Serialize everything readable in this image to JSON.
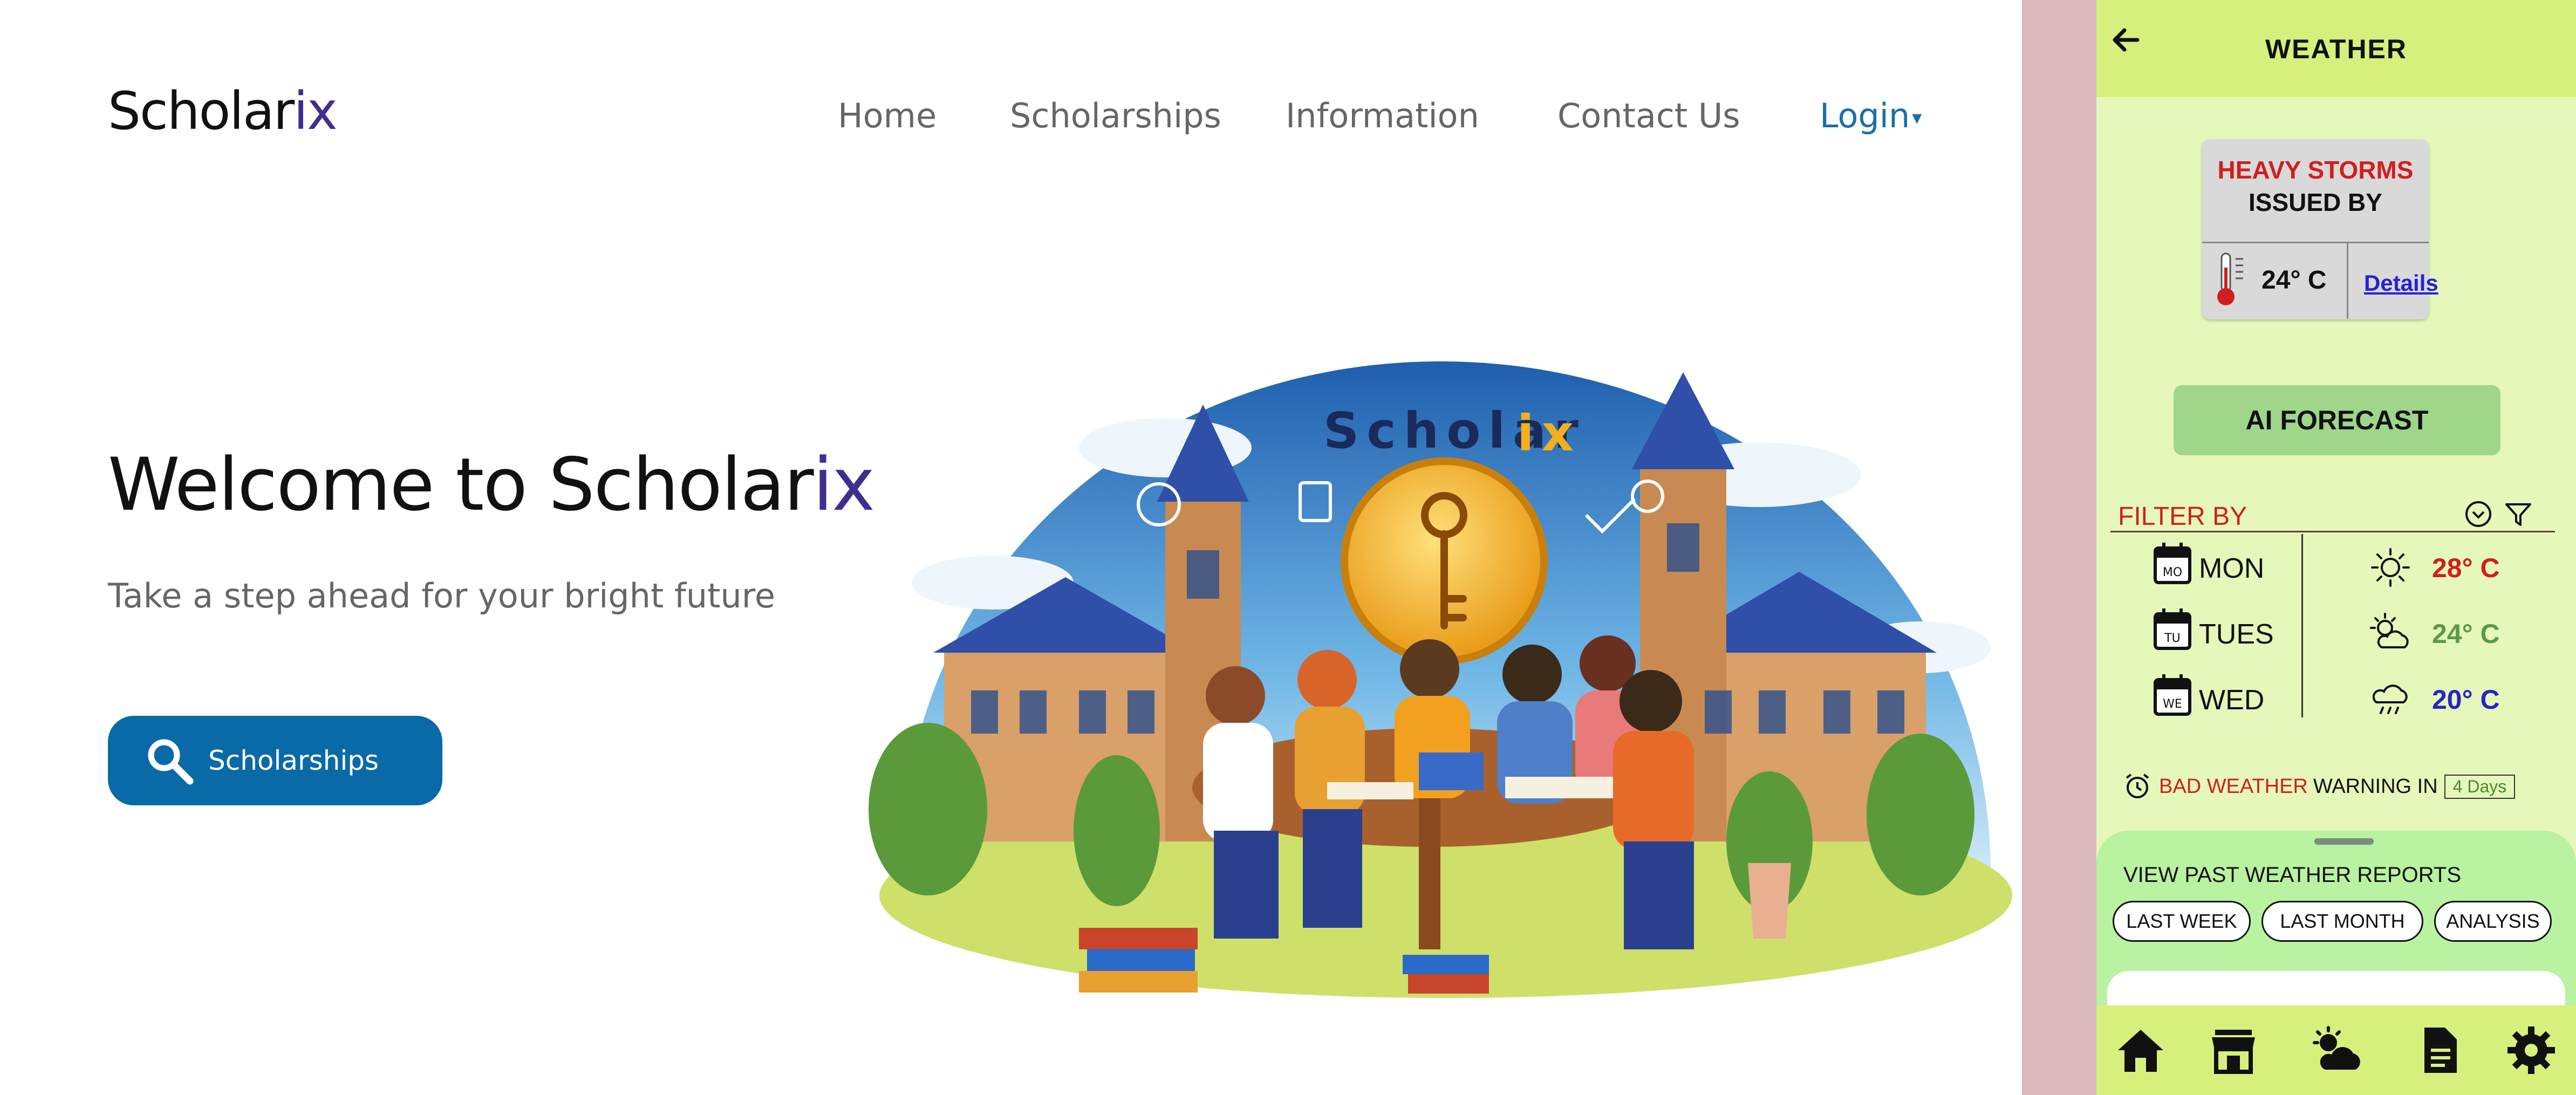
{
  "header": {
    "logo_main": "Schol",
    "logo_mid": "ar",
    "logo_accent": "ix",
    "nav": [
      {
        "label": "Home"
      },
      {
        "label": "Scholarships"
      },
      {
        "label": "Information"
      },
      {
        "label": "Contact Us"
      }
    ],
    "login_label": "Login",
    "login_caret": "▾"
  },
  "hero": {
    "title_main": "Welcome to Scholar",
    "title_accent": "ix",
    "subtitle": "Take a step ahead for your bright future",
    "cta_label": "Scholarships",
    "cta_icon": "search-icon"
  },
  "illustration": {
    "banner_main": "Scholar",
    "banner_accent": "ix",
    "accent_color": "#f2b01e"
  },
  "weather_panel": {
    "title": "WEATHER",
    "back_icon": "arrow-left-icon",
    "alert": {
      "line1": "HEAVY STORMS",
      "line2": "ISSUED BY",
      "temp": "24° C",
      "details_link": "Details"
    },
    "ai_button": "AI FORECAST",
    "filter_label": "FILTER BY",
    "days": [
      {
        "abbr": "MO",
        "name": "MON",
        "icon": "sun-icon",
        "temp": "28° C",
        "temp_color": "#d11e1e"
      },
      {
        "abbr": "TU",
        "name": "TUES",
        "icon": "cloudy-sun-icon",
        "temp": "24° C",
        "temp_color": "#5a9a48"
      },
      {
        "abbr": "WE",
        "name": "WED",
        "icon": "rain-cloud-icon",
        "temp": "20° C",
        "temp_color": "#2524c8"
      }
    ],
    "warning": {
      "red_text": "BAD WEATHER",
      "black_text": "WARNING IN",
      "badge": "4 Days"
    },
    "past_reports": {
      "title": "VIEW PAST WEATHER REPORTS",
      "chips": [
        "LAST WEEK",
        "LAST MONTH",
        "ANALYSIS"
      ]
    },
    "bottom_nav": [
      "home-icon",
      "store-icon",
      "weather-icon",
      "document-icon",
      "settings-icon"
    ]
  }
}
